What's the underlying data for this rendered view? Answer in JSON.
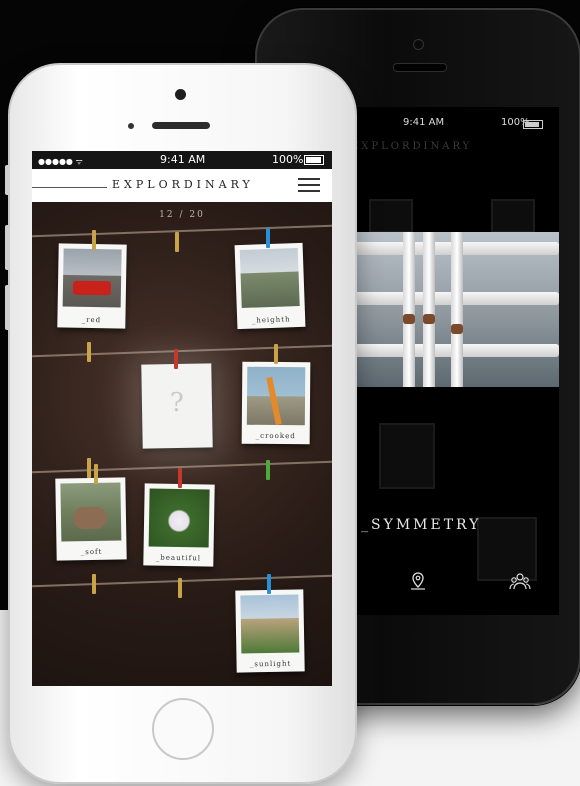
{
  "front_phone": {
    "status": {
      "signal": "●●●●● ᯤ",
      "time": "9:41 AM",
      "battery": "100%"
    },
    "brand": "EXPLORDINARY",
    "counter": "12 / 20",
    "mystery_mark": "?",
    "cards": [
      {
        "caption": "_red",
        "photo": "red-van-photo"
      },
      {
        "caption": "_heighth",
        "photo": "stairs-photo"
      },
      {
        "caption": "_crooked",
        "photo": "crooked-pole-photo"
      },
      {
        "caption": "_soft",
        "photo": "dog-photo"
      },
      {
        "caption": "_beautiful",
        "photo": "lotus-photo"
      },
      {
        "caption": "_sunlight",
        "photo": "building-photo"
      }
    ],
    "pin_colors": [
      "#c9a34a",
      "#c9a34a",
      "#2a8fd6",
      "#c9a34a",
      "#c23a2e",
      "#c9a34a",
      "#c9a34a",
      "#4fa83c",
      "#c9a34a",
      "#c23a2e",
      "#c9a34a",
      "#c9a34a",
      "#c9a34a",
      "#2a8fd6"
    ]
  },
  "back_phone": {
    "status": {
      "time": "9:41 AM",
      "battery": "100%"
    },
    "brand": "EXPLORDINARY",
    "title": "_SYMMETRY",
    "icons": [
      "map-pin-icon",
      "group-icon"
    ]
  }
}
